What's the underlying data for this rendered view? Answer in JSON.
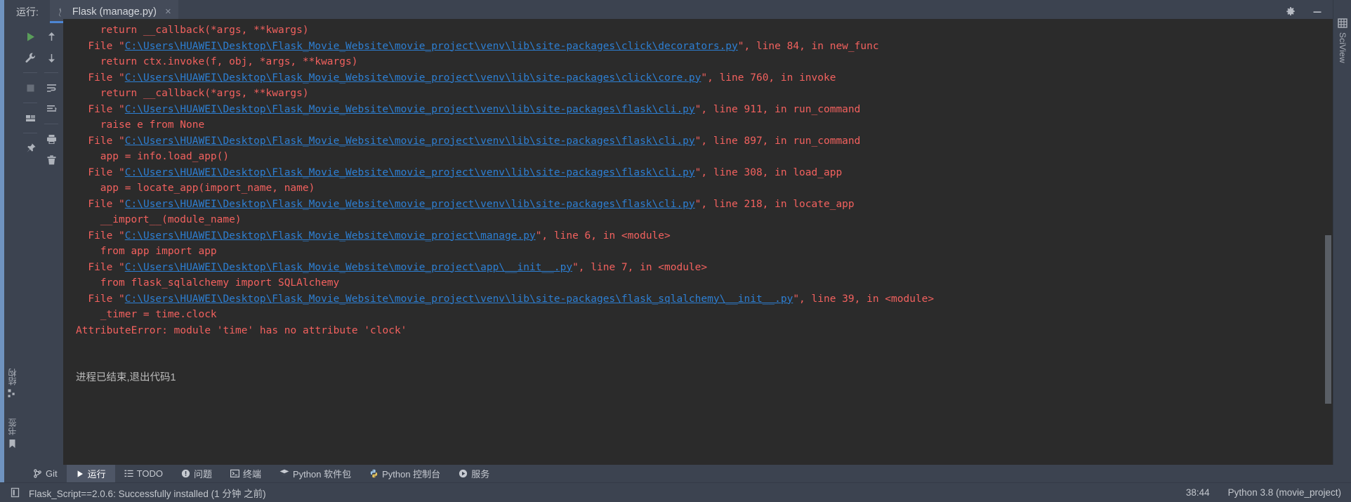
{
  "window": {
    "run_label": "运行:",
    "tab_title": "Flask (manage.py)",
    "tab_close": "×",
    "gear_icon": "gear-icon",
    "minimize_icon": "minimize-icon"
  },
  "left_toolbar": {
    "column1": [
      {
        "name": "rerun-button",
        "icon": "play-icon",
        "title": "Rerun"
      },
      {
        "name": "settings-button",
        "icon": "wrench-icon",
        "title": "Settings"
      },
      {
        "name": "stop-button",
        "icon": "stop-square-icon",
        "title": "Stop"
      },
      {
        "name": "layout-button",
        "icon": "layout-icon",
        "title": "Layout"
      },
      {
        "name": "pin-button",
        "icon": "pin-icon",
        "title": "Pin Tab"
      }
    ],
    "column2": [
      {
        "name": "up-stack-trace-button",
        "icon": "arrow-up-icon",
        "title": "Up the Stack Trace"
      },
      {
        "name": "down-stack-trace-button",
        "icon": "arrow-down-icon",
        "title": "Down the Stack Trace"
      },
      {
        "name": "soft-wrap-button",
        "icon": "soft-wrap-icon",
        "title": "Soft-Wrap"
      },
      {
        "name": "scroll-to-end-button",
        "icon": "scroll-to-end-icon",
        "title": "Scroll to End"
      },
      {
        "name": "print-button",
        "icon": "printer-icon",
        "title": "Print"
      },
      {
        "name": "clear-all-button",
        "icon": "trash-icon",
        "title": "Clear All"
      }
    ]
  },
  "left_strip": {
    "items": [
      {
        "label": "结构",
        "icon": "structure-icon",
        "name": "tool-window-structure"
      },
      {
        "label": "书签",
        "icon": "bookmark-icon",
        "name": "tool-window-bookmarks"
      }
    ]
  },
  "right_strip": {
    "items": [
      {
        "label": "SciView",
        "icon": "grid-icon",
        "name": "tool-window-sciview"
      }
    ]
  },
  "console": {
    "lines": [
      {
        "indent": 4,
        "segments": [
          {
            "t": "return __callback(*args, **kwargs)",
            "c": "err"
          }
        ]
      },
      {
        "indent": 2,
        "segments": [
          {
            "t": "File \"",
            "c": "err"
          },
          {
            "t": "C:\\Users\\HUAWEI\\Desktop\\Flask_Movie_Website\\movie_project\\venv\\lib\\site-packages\\click\\decorators.py",
            "c": "lnk"
          },
          {
            "t": "\", line 84, in new_func",
            "c": "err"
          }
        ]
      },
      {
        "indent": 4,
        "segments": [
          {
            "t": "return ctx.invoke(f, obj, *args, **kwargs)",
            "c": "err"
          }
        ]
      },
      {
        "indent": 2,
        "segments": [
          {
            "t": "File \"",
            "c": "err"
          },
          {
            "t": "C:\\Users\\HUAWEI\\Desktop\\Flask_Movie_Website\\movie_project\\venv\\lib\\site-packages\\click\\core.py",
            "c": "lnk"
          },
          {
            "t": "\", line 760, in invoke",
            "c": "err"
          }
        ]
      },
      {
        "indent": 4,
        "segments": [
          {
            "t": "return __callback(*args, **kwargs)",
            "c": "err"
          }
        ]
      },
      {
        "indent": 2,
        "segments": [
          {
            "t": "File \"",
            "c": "err"
          },
          {
            "t": "C:\\Users\\HUAWEI\\Desktop\\Flask_Movie_Website\\movie_project\\venv\\lib\\site-packages\\flask\\cli.py",
            "c": "lnk"
          },
          {
            "t": "\", line 911, in run_command",
            "c": "err"
          }
        ]
      },
      {
        "indent": 4,
        "segments": [
          {
            "t": "raise e from None",
            "c": "err"
          }
        ]
      },
      {
        "indent": 2,
        "segments": [
          {
            "t": "File \"",
            "c": "err"
          },
          {
            "t": "C:\\Users\\HUAWEI\\Desktop\\Flask_Movie_Website\\movie_project\\venv\\lib\\site-packages\\flask\\cli.py",
            "c": "lnk"
          },
          {
            "t": "\", line 897, in run_command",
            "c": "err"
          }
        ]
      },
      {
        "indent": 4,
        "segments": [
          {
            "t": "app = info.load_app()",
            "c": "err"
          }
        ]
      },
      {
        "indent": 2,
        "segments": [
          {
            "t": "File \"",
            "c": "err"
          },
          {
            "t": "C:\\Users\\HUAWEI\\Desktop\\Flask_Movie_Website\\movie_project\\venv\\lib\\site-packages\\flask\\cli.py",
            "c": "lnk"
          },
          {
            "t": "\", line 308, in load_app",
            "c": "err"
          }
        ]
      },
      {
        "indent": 4,
        "segments": [
          {
            "t": "app = locate_app(import_name, name)",
            "c": "err"
          }
        ]
      },
      {
        "indent": 2,
        "segments": [
          {
            "t": "File \"",
            "c": "err"
          },
          {
            "t": "C:\\Users\\HUAWEI\\Desktop\\Flask_Movie_Website\\movie_project\\venv\\lib\\site-packages\\flask\\cli.py",
            "c": "lnk"
          },
          {
            "t": "\", line 218, in locate_app",
            "c": "err"
          }
        ]
      },
      {
        "indent": 4,
        "segments": [
          {
            "t": "__import__(module_name)",
            "c": "err"
          }
        ]
      },
      {
        "indent": 2,
        "segments": [
          {
            "t": "File \"",
            "c": "err"
          },
          {
            "t": "C:\\Users\\HUAWEI\\Desktop\\Flask_Movie_Website\\movie_project\\manage.py",
            "c": "lnk"
          },
          {
            "t": "\", line 6, in <module>",
            "c": "err"
          }
        ]
      },
      {
        "indent": 4,
        "segments": [
          {
            "t": "from app import app",
            "c": "err"
          }
        ]
      },
      {
        "indent": 2,
        "segments": [
          {
            "t": "File \"",
            "c": "err"
          },
          {
            "t": "C:\\Users\\HUAWEI\\Desktop\\Flask_Movie_Website\\movie_project\\app\\__init__.py",
            "c": "lnk"
          },
          {
            "t": "\", line 7, in <module>",
            "c": "err"
          }
        ]
      },
      {
        "indent": 4,
        "segments": [
          {
            "t": "from flask_sqlalchemy import SQLAlchemy",
            "c": "err"
          }
        ]
      },
      {
        "indent": 2,
        "segments": [
          {
            "t": "File \"",
            "c": "err"
          },
          {
            "t": "C:\\Users\\HUAWEI\\Desktop\\Flask_Movie_Website\\movie_project\\venv\\lib\\site-packages\\flask_sqlalchemy\\__init__.py",
            "c": "lnk"
          },
          {
            "t": "\", line 39, in <module>",
            "c": "err"
          }
        ]
      },
      {
        "indent": 4,
        "segments": [
          {
            "t": "_timer = time.clock",
            "c": "err"
          }
        ]
      },
      {
        "indent": 0,
        "segments": [
          {
            "t": "AttributeError: module 'time' has no attribute 'clock'",
            "c": "err"
          }
        ]
      },
      {
        "indent": 0,
        "blank": true,
        "segments": []
      },
      {
        "indent": 0,
        "blank": true,
        "segments": []
      },
      {
        "indent": 0,
        "segments": [
          {
            "t": "进程已结束,退出代码1",
            "c": "gray"
          }
        ]
      }
    ],
    "colors": {
      "background": "#2b2b2b",
      "error_text": "#f2615e",
      "link_text": "#2d7fd3",
      "plain_text": "#bbbbbb"
    }
  },
  "bottom_bar": {
    "items": [
      {
        "label": "Git",
        "icon": "git-branch-icon",
        "name": "bottom-tab-git",
        "active": false
      },
      {
        "label": "运行",
        "icon": "play-icon",
        "name": "bottom-tab-run",
        "active": true
      },
      {
        "label": "TODO",
        "icon": "todo-list-icon",
        "name": "bottom-tab-todo",
        "active": false
      },
      {
        "label": "问题",
        "icon": "problems-icon",
        "name": "bottom-tab-problems",
        "active": false
      },
      {
        "label": "终端",
        "icon": "terminal-icon",
        "name": "bottom-tab-terminal",
        "active": false
      },
      {
        "label": "Python 软件包",
        "icon": "packages-icon",
        "name": "bottom-tab-python-packages",
        "active": false
      },
      {
        "label": "Python 控制台",
        "icon": "python-icon",
        "name": "bottom-tab-python-console",
        "active": false
      },
      {
        "label": "服务",
        "icon": "services-icon",
        "name": "bottom-tab-services",
        "active": false
      }
    ]
  },
  "status_bar": {
    "icon": "event-log-icon",
    "message": "Flask_Script==2.0.6: Successfully installed (1 分钟 之前)",
    "caret_position": "38:44",
    "interpreter": "Python 3.8 (movie_project)"
  }
}
